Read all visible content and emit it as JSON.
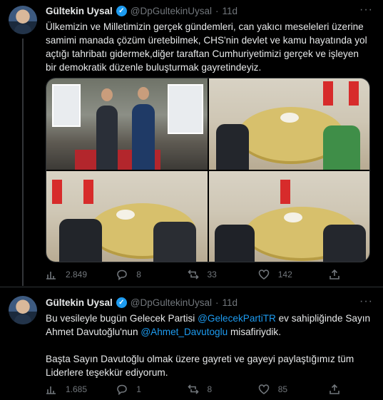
{
  "tweets": [
    {
      "author_name": "Gültekin Uysal",
      "handle": "@DpGultekinUysal",
      "separator": "·",
      "time": "11d",
      "more": "···",
      "text": "Ülkemizin ve Milletimizin gerçek gündemleri, can yakıcı meseleleri üzerine samimi manada çözüm üretebilmek, CHS'nin devlet ve kamu hayatında yol açtığı tahribatı gidermek,diğer taraftan Cumhuriyetimizi gerçek ve işleyen bir demokratik düzenle buluşturmak gayretindeyiz.",
      "stats": {
        "views": "2.849",
        "replies": "8",
        "retweets": "33",
        "likes": "142"
      }
    },
    {
      "author_name": "Gültekin Uysal",
      "handle": "@DpGultekinUysal",
      "separator": "·",
      "time": "11d",
      "more": "···",
      "text_p1_a": "Bu vesileyle bugün Gelecek Partisi ",
      "text_p1_mention1": "@GelecekPartiTR",
      "text_p1_b": " ev sahipliğinde Sayın Ahmet Davutoğlu'nun ",
      "text_p1_mention2": "@Ahmet_Davutoglu",
      "text_p1_c": " misafiriydik.",
      "text_p2": "Başta Sayın Davutoğlu olmak üzere gayreti ve gayeyi paylaştığımız tüm Liderlere teşekkür ediyorum.",
      "stats": {
        "views": "1.685",
        "replies": "1",
        "retweets": "8",
        "likes": "85"
      }
    }
  ],
  "colors": {
    "background": "#000000",
    "text": "#e7e9ea",
    "muted": "#71767b",
    "accent": "#1d9bf0",
    "divider": "#2f3336"
  }
}
